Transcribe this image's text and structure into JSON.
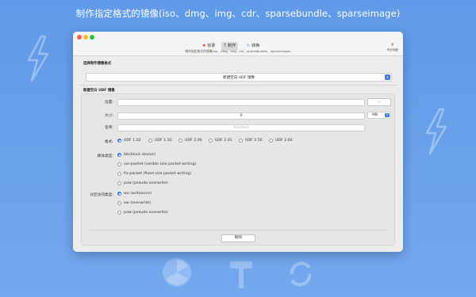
{
  "headline": "制作指定格式的镜像(iso、dmg、img、cdr、sparsebundle、sparseimage)",
  "window": {
    "toolbar": {
      "tabs": [
        {
          "label": "刻录",
          "icon": "radiation-icon"
        },
        {
          "label": "制作",
          "icon": "hammer-icon"
        },
        {
          "label": "转换",
          "icon": "refresh-icon"
        }
      ],
      "subtitle": "制作指定格式的镜像(iso、dmg、img、cdr、sparsebundle、sparseimage)",
      "pro_label": "专业功能",
      "pro_icon": "key-icon"
    },
    "format_section": {
      "title": "选择制作镜像格式",
      "selected": "新建空白 UDF 镜像"
    },
    "udf_section": {
      "title": "新建空白 UDF 镜像",
      "location": {
        "label": "位置:",
        "value": "",
        "browse_label": "..."
      },
      "size": {
        "label": "大小:",
        "value": "0",
        "unit": "MB"
      },
      "name": {
        "label": "名称:",
        "placeholder": "Untitled"
      },
      "format": {
        "label": "格式:",
        "options": [
          "UDF 1.02",
          "UDF 1.50",
          "UDF 2.00",
          "UDF 2.01",
          "UDF 2.50",
          "UDF 2.60"
        ],
        "selected_index": 0
      },
      "media_type": {
        "label": "媒体类型:",
        "options": [
          "blk(block device)",
          "var-packet (varible size packet writing)",
          "fix-packet (fixed size packet writing)",
          "pow (pseudo overwrite)"
        ],
        "selected_index": 0
      },
      "partition_access": {
        "label": "分区访问类型:",
        "options": [
          "wo (writeonce)",
          "ow (overwrite)",
          "pow (pseudo overwrite)"
        ],
        "selected_index": 0
      },
      "make_button": "制作"
    }
  },
  "colors": {
    "accent": "#3a7ce8",
    "background": "#6aa3ec"
  }
}
